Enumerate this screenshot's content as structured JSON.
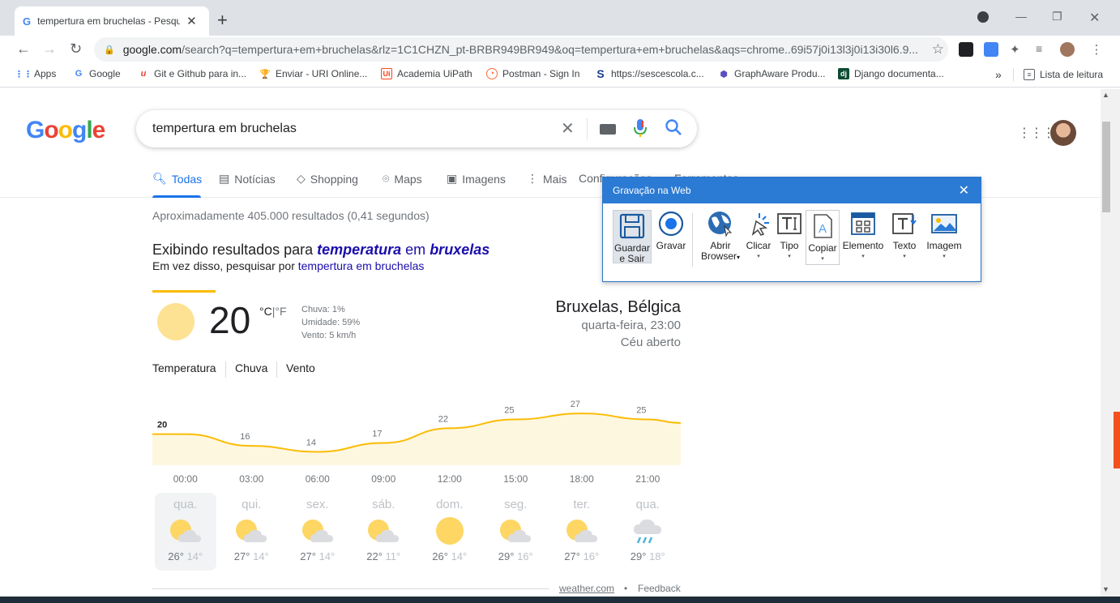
{
  "browser": {
    "tab_title": "tempertura em bruchelas - Pesqu",
    "url_host": "google.com",
    "url_rest": "/search?q=tempertura+em+bruchelas&rlz=1C1CHZN_pt-BRBR949BR949&oq=tempertura+em+bruchelas&aqs=chrome..69i57j0i13l3j0i13i30l6.9...",
    "bookmarks": [
      {
        "label": "Apps"
      },
      {
        "label": "Google"
      },
      {
        "label": "Git e Github para in..."
      },
      {
        "label": "Enviar - URI Online..."
      },
      {
        "label": "Academia UiPath"
      },
      {
        "label": "Postman - Sign In"
      },
      {
        "label": "https://sescescola.c..."
      },
      {
        "label": "GraphAware Produ..."
      },
      {
        "label": "Django documenta..."
      }
    ],
    "bookmarks_overflow": "»",
    "reading_list": "Lista de leitura"
  },
  "google": {
    "logo": [
      "G",
      "o",
      "o",
      "g",
      "l",
      "e"
    ],
    "query": "tempertura em bruchelas",
    "tabs": [
      "Todas",
      "Notícias",
      "Shopping",
      "Maps",
      "Imagens",
      "Mais",
      "Configurações",
      "Ferramentas"
    ],
    "stats": "Aproximadamente 405.000 resultados (0,41 segundos)",
    "showing_prefix": "Exibindo resultados para ",
    "showing_word1": "temperatura",
    "showing_mid": " em ",
    "showing_word2": "bruxelas",
    "instead_prefix": "Em vez disso, pesquisar por ",
    "instead_link": "tempertura em bruchelas"
  },
  "weather": {
    "temp": "20",
    "unit_c": "°C",
    "unit_sep": "|",
    "unit_f": "°F",
    "rain": "Chuva: 1%",
    "humidity": "Umidade: 59%",
    "wind": "Vento: 5 km/h",
    "city": "Bruxelas, Bélgica",
    "datetime": "quarta-feira, 23:00",
    "condition": "Céu aberto",
    "tabs": [
      "Temperatura",
      "Chuva",
      "Vento"
    ],
    "hourly_times": [
      "00:00",
      "03:00",
      "06:00",
      "09:00",
      "12:00",
      "15:00",
      "18:00",
      "21:00"
    ],
    "days": [
      {
        "name": "qua.",
        "high": "26°",
        "low": "14°",
        "icon": "partly-cloudy"
      },
      {
        "name": "qui.",
        "high": "27°",
        "low": "14°",
        "icon": "partly-cloudy"
      },
      {
        "name": "sex.",
        "high": "27°",
        "low": "14°",
        "icon": "partly-cloudy"
      },
      {
        "name": "sáb.",
        "high": "22°",
        "low": "11°",
        "icon": "partly-cloudy"
      },
      {
        "name": "dom.",
        "high": "26°",
        "low": "14°",
        "icon": "sunny"
      },
      {
        "name": "seg.",
        "high": "29°",
        "low": "16°",
        "icon": "partly-cloudy"
      },
      {
        "name": "ter.",
        "high": "27°",
        "low": "16°",
        "icon": "partly-cloudy"
      },
      {
        "name": "qua.",
        "high": "29°",
        "low": "18°",
        "icon": "rain-cloud"
      }
    ],
    "source": "weather.com",
    "dot": "•",
    "feedback": "Feedback"
  },
  "chart_data": {
    "type": "area",
    "x": [
      "00:00",
      "03:00",
      "06:00",
      "09:00",
      "12:00",
      "15:00",
      "18:00",
      "21:00"
    ],
    "values": [
      20,
      16,
      14,
      17,
      22,
      25,
      27,
      25
    ],
    "ylabel": "Temperatura",
    "line_color": "#fbbc04",
    "fill_color": "#fef7e0"
  },
  "recorder": {
    "title": "Gravação na Web",
    "buttons": [
      {
        "label1": "Guardar",
        "label2": "e Sair",
        "icon": "save-icon"
      },
      {
        "label1": "Gravar",
        "label2": "",
        "icon": "record-icon"
      },
      {
        "label1": "Abrir",
        "label2": "Browser",
        "icon": "globe-icon"
      },
      {
        "label1": "Clicar",
        "label2": "",
        "icon": "click-icon"
      },
      {
        "label1": "Tipo",
        "label2": "",
        "icon": "type-icon"
      },
      {
        "label1": "Copiar",
        "label2": "",
        "icon": "copy-icon"
      },
      {
        "label1": "Elemento",
        "label2": "",
        "icon": "element-icon"
      },
      {
        "label1": "Texto",
        "label2": "",
        "icon": "text-icon"
      },
      {
        "label1": "Imagem",
        "label2": "",
        "icon": "image-icon"
      }
    ],
    "dropdown_glyph": "▾"
  },
  "colors": {
    "google_blue": "#4285f4",
    "google_red": "#ea4335",
    "google_yellow": "#fbbc04",
    "google_green": "#34a853",
    "link": "#1a0dab",
    "recorder_blue": "#2b7bd5"
  }
}
